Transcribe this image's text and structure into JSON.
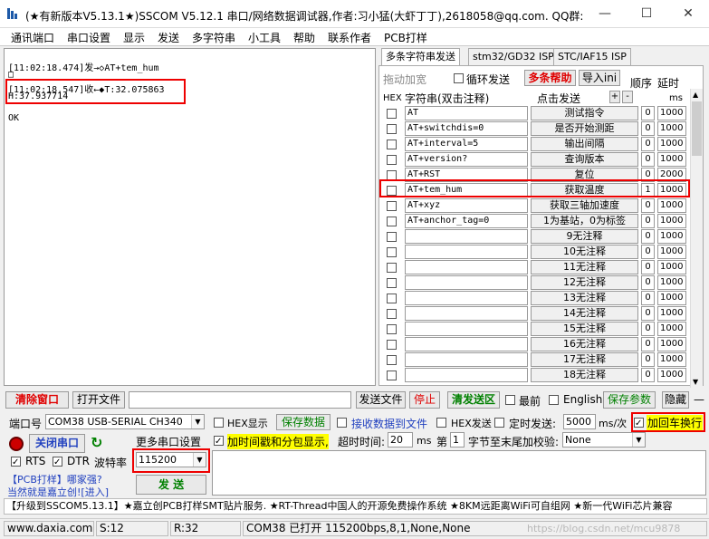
{
  "window": {
    "title": "(★有新版本V5.13.1★)SSCOM V5.12.1 串口/网络数据调试器,作者:习小猛(大虾丁丁),2618058@qq.com. QQ群:",
    "minimize": "—",
    "maximize": "☐",
    "close": "✕"
  },
  "menu": [
    "通讯端口",
    "串口设置",
    "显示",
    "发送",
    "多字符串",
    "小工具",
    "帮助",
    "联系作者",
    "PCB打样"
  ],
  "log": {
    "line1": "[11:02:18.474]发→◇AT+tem_hum",
    "line2": "□",
    "line3": "[11:02:18.547]收←◆T:32.075863",
    "line4": "H:37.937714",
    "line5": "",
    "line6": "OK"
  },
  "tabs": [
    "多条字符串发送",
    "stm32/GD32 ISP",
    "STC/IAF15 ISP"
  ],
  "multi": {
    "auto_label": "拖动加宽",
    "loop_label": "循环发送",
    "help_btn": "多条帮助",
    "import_btn": "导入ini",
    "order_hdr": "顺序",
    "delay_hdr": "延时",
    "hex_hdr": "HEX",
    "str_hdr": "字符串(双击注释)",
    "click_hdr": "点击发送",
    "plus": "+",
    "minus": "-",
    "ms_hdr": "ms",
    "rows": [
      {
        "cmd": "AT",
        "act": "测试指令",
        "ord": "0",
        "dly": "1000"
      },
      {
        "cmd": "AT+switchdis=0",
        "act": "是否开始测距",
        "ord": "0",
        "dly": "1000"
      },
      {
        "cmd": "AT+interval=5",
        "act": "输出间隔",
        "ord": "0",
        "dly": "1000"
      },
      {
        "cmd": "AT+version?",
        "act": "查询版本",
        "ord": "0",
        "dly": "1000"
      },
      {
        "cmd": "AT+RST",
        "act": "复位",
        "ord": "0",
        "dly": "2000"
      },
      {
        "cmd": "AT+tem_hum",
        "act": "获取温度",
        "ord": "1",
        "dly": "1000"
      },
      {
        "cmd": "AT+xyz",
        "act": "获取三轴加速度",
        "ord": "0",
        "dly": "1000"
      },
      {
        "cmd": "AT+anchor_tag=0",
        "act": "1为基站，0为标签",
        "ord": "0",
        "dly": "1000"
      },
      {
        "cmd": "",
        "act": "9无注释",
        "ord": "0",
        "dly": "1000"
      },
      {
        "cmd": "",
        "act": "10无注释",
        "ord": "0",
        "dly": "1000"
      },
      {
        "cmd": "",
        "act": "11无注释",
        "ord": "0",
        "dly": "1000"
      },
      {
        "cmd": "",
        "act": "12无注释",
        "ord": "0",
        "dly": "1000"
      },
      {
        "cmd": "",
        "act": "13无注释",
        "ord": "0",
        "dly": "1000"
      },
      {
        "cmd": "",
        "act": "14无注释",
        "ord": "0",
        "dly": "1000"
      },
      {
        "cmd": "",
        "act": "15无注释",
        "ord": "0",
        "dly": "1000"
      },
      {
        "cmd": "",
        "act": "16无注释",
        "ord": "0",
        "dly": "1000"
      },
      {
        "cmd": "",
        "act": "17无注释",
        "ord": "0",
        "dly": "1000"
      },
      {
        "cmd": "",
        "act": "18无注释",
        "ord": "0",
        "dly": "1000"
      }
    ]
  },
  "toolbar": {
    "clear_btn": "清除窗口",
    "open_file_btn": "打开文件",
    "send_file_btn": "发送文件",
    "stop_btn": "停止",
    "clear_send_btn": "清发送区",
    "topmost": "最前",
    "english": "English",
    "save_params": "保存参数",
    "hide": "隐藏",
    "collapse": "—"
  },
  "port": {
    "port_label": "端口号",
    "port_value": "COM38 USB-SERIAL CH340",
    "hex_display": "HEX显示",
    "save_data": "保存数据",
    "recv_to_file": "接收数据到文件",
    "hex_send": "HEX发送",
    "timed_send": "定时发送:",
    "timed_value": "5000",
    "timed_unit": "ms/次",
    "add_crlf": "加回车换行",
    "close_port": "关闭串口",
    "more_settings": "更多串口设置",
    "timestamp": "加时间戳和分包显示,",
    "timeout_label": "超时时间:",
    "timeout_value": "20",
    "ms": "ms",
    "nth_label": "第",
    "nth_value": "1",
    "byte_tail": "字节至末尾加校验:",
    "check_value": "None",
    "rts": "RTS",
    "dtr": "DTR",
    "baud_label": "波特率",
    "baud_value": "115200",
    "send_btn": "发 送",
    "pcb_ad1": "【PCB打样】哪家强?",
    "pcb_ad2": "当然就是嘉立创![进入]"
  },
  "ticker": "【升级到SSCOM5.13.1】★嘉立创PCB打样SMT贴片服务. ★RT-Thread中国人的开源免费操作系统 ★8KM远距离WiFi可自组网 ★新一代WiFi芯片兼容",
  "statusbar": {
    "site": "www.daxia.com",
    "s": "S:12",
    "r": "R:32",
    "info": "COM38 已打开  115200bps,8,1,None,None",
    "watermark": "https://blog.csdn.net/mcu9878"
  },
  "colors": {
    "highlight": "#e00000",
    "accent_green": "#008000",
    "yellow": "#ffff00"
  }
}
